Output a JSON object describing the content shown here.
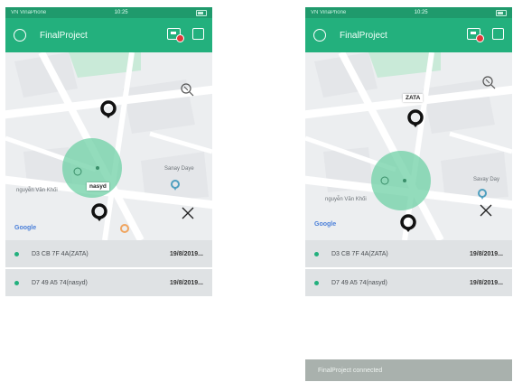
{
  "status_bar": {
    "left": "VN VinaPhone",
    "center": "10:25"
  },
  "app": {
    "title": "FinalProject"
  },
  "colors": {
    "primary": "#23b07d",
    "status": "#1f9a6c",
    "accent_record": "#e0383a"
  },
  "icons": {
    "nav": "circle-icon",
    "device": "device-record-icon",
    "window": "square-icon",
    "zoom": "zoom-icon",
    "expand": "expand-arrows-icon"
  },
  "left": {
    "pin_label": "nasyd",
    "map_labels": {
      "shop": "Sanay Daye",
      "street": "nguyễn Văn Khối"
    },
    "google": "Google",
    "devices": [
      {
        "id": "D3 CB 7F 4A(ZATA)",
        "date": "19/8/2019..."
      },
      {
        "id": "D7 49 A5 74(nasyd)",
        "date": "19/8/2019..."
      }
    ]
  },
  "right": {
    "pin_label": "ZATA",
    "map_labels": {
      "shop": "Savay Day",
      "street": "nguyễn Văn Khối"
    },
    "google": "Google",
    "devices": [
      {
        "id": "D3 CB 7F 4A(ZATA)",
        "date": "19/8/2019..."
      },
      {
        "id": "D7 49 A5 74(nasyd)",
        "date": "19/8/2019..."
      }
    ]
  },
  "snackbar": {
    "text": "FinalProject connected"
  }
}
